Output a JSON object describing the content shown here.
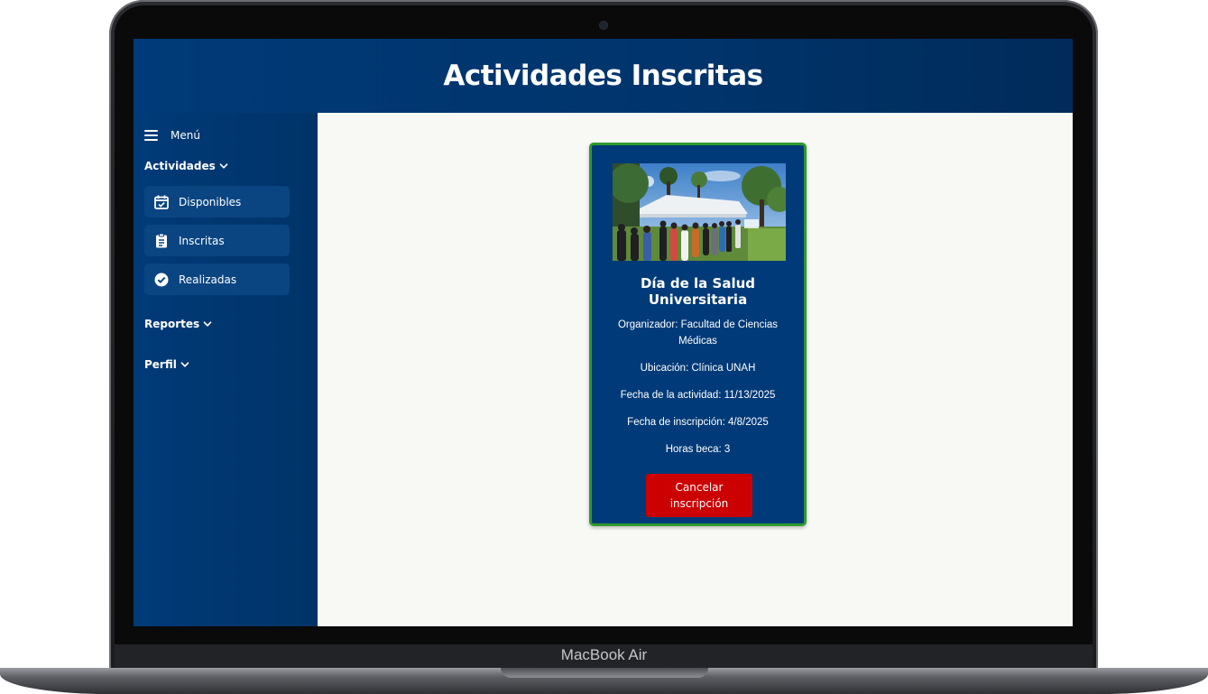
{
  "device": {
    "label": "MacBook Air"
  },
  "header": {
    "title": "Actividades Inscritas"
  },
  "sidebar": {
    "menu_label": "Menú",
    "sections": [
      {
        "label": "Actividades",
        "expanded": true,
        "items": [
          {
            "label": "Disponibles",
            "icon": "calendar-check-icon"
          },
          {
            "label": "Inscritas",
            "icon": "clipboard-icon"
          },
          {
            "label": "Realizadas",
            "icon": "check-circle-icon"
          }
        ]
      },
      {
        "label": "Reportes",
        "expanded": false
      },
      {
        "label": "Perfil",
        "expanded": false
      }
    ]
  },
  "activity_card": {
    "title": "Día de la Salud Universitaria",
    "organizer": "Organizador: Facultad de Ciencias Médicas",
    "location": "Ubicación: Clínica UNAH",
    "activity_date": "Fecha de la actividad: 11/13/2025",
    "registration_date": "Fecha de inscripción: 4/8/2025",
    "hours": "Horas beca: 3",
    "cancel_label": "Cancelar inscripción"
  },
  "colors": {
    "primary": "#003a78",
    "card_border": "#2e9a2e",
    "danger": "#cc0000",
    "content_bg": "#f8f9f5"
  }
}
